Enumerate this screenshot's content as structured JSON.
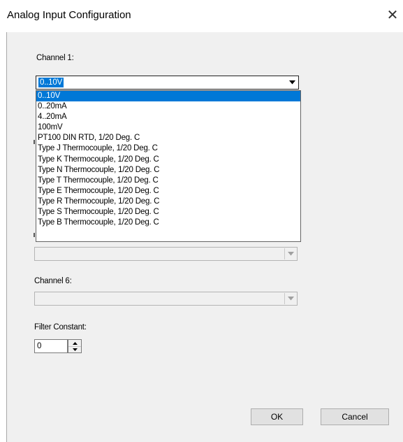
{
  "window": {
    "title": "Analog Input Configuration"
  },
  "channel1": {
    "label": "Channel 1:",
    "selected_value": "0..10V",
    "options": [
      "0..10V",
      "0..20mA",
      "4..20mA",
      "100mV",
      "PT100 DIN RTD, 1/20 Deg. C",
      "Type J Thermocouple, 1/20 Deg. C",
      "Type K Thermocouple, 1/20 Deg. C",
      "Type N Thermocouple, 1/20 Deg. C",
      "Type T Thermocouple, 1/20 Deg. C",
      "Type E Thermocouple, 1/20 Deg. C",
      "Type R Thermocouple, 1/20 Deg. C",
      "Type S Thermocouple, 1/20 Deg. C",
      "Type B Thermocouple, 1/20 Deg. C"
    ],
    "highlighted_option": "0..10V"
  },
  "channel5": {
    "value": ""
  },
  "channel6": {
    "label": "Channel 6:",
    "value": ""
  },
  "filter": {
    "label": "Filter Constant:",
    "value": "0"
  },
  "buttons": {
    "ok": "OK",
    "cancel": "Cancel"
  },
  "colors": {
    "selection": "#0078d7",
    "dialog_bg": "#f0f0f0"
  },
  "icons": {
    "close": "close-icon",
    "dropdown": "chevron-down-icon",
    "spin_up": "arrow-up-icon",
    "spin_down": "arrow-down-icon"
  }
}
